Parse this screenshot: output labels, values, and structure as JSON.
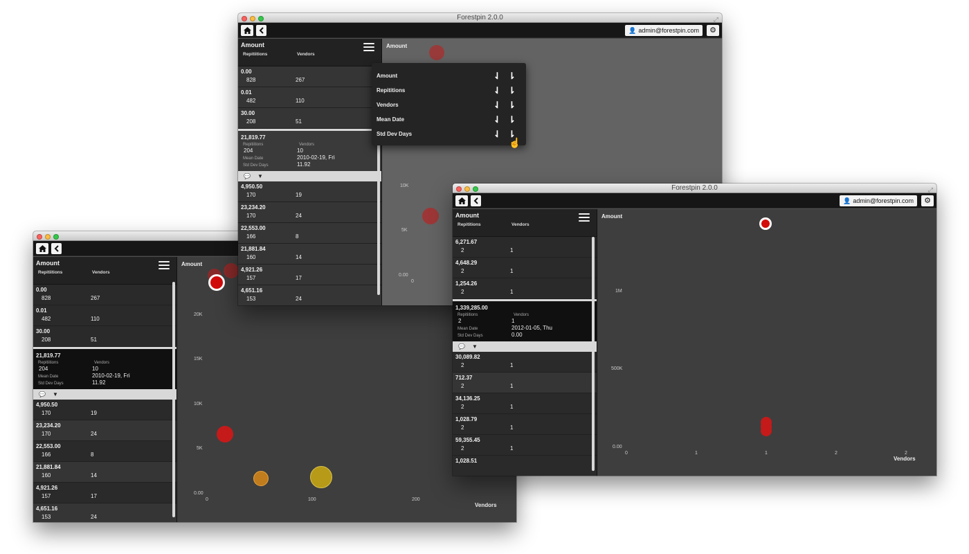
{
  "app": {
    "title": "Forestpin 2.0.0",
    "user": "admin@forestpin.com"
  },
  "panel": {
    "title": "Amount",
    "col_reps": "Repitiitions",
    "col_vendors": "Vendors",
    "detail_reps": "Repitiitions",
    "detail_vendors": "Vendors",
    "detail_mean": "Mean Date",
    "detail_std": "Std Dev Days"
  },
  "panel_right": {
    "col_reps": "Repititions"
  },
  "list_a": [
    {
      "amount": "0.00",
      "reps": "828",
      "vendors": "267"
    },
    {
      "amount": "0.01",
      "reps": "482",
      "vendors": "110"
    },
    {
      "amount": "30.00",
      "reps": "208",
      "vendors": "51"
    }
  ],
  "selected_a": {
    "amount": "21,819.77",
    "reps": "204",
    "vendors": "10",
    "mean_date": "2010-02-19, Fri",
    "std_dev": "11.92"
  },
  "list_a2_top": [
    {
      "amount": "4,950.50",
      "reps": "170",
      "vendors": "19"
    },
    {
      "amount": "23,234.20",
      "reps": "170",
      "vendors": "24"
    },
    {
      "amount": "22,553.00",
      "reps": "166",
      "vendors": "8"
    },
    {
      "amount": "21,881.84",
      "reps": "160",
      "vendors": "14"
    },
    {
      "amount": "4,921.26",
      "reps": "157",
      "vendors": "17"
    },
    {
      "amount": "4,651.16",
      "reps": "153",
      "vendors": "24"
    }
  ],
  "list_b_top": [
    {
      "amount": "6,271.67",
      "reps": "2",
      "vendors": "1"
    },
    {
      "amount": "4,648.29",
      "reps": "2",
      "vendors": "1"
    },
    {
      "amount": "1,254.26",
      "reps": "2",
      "vendors": "1"
    }
  ],
  "selected_b": {
    "amount": "1,339,285.00",
    "reps": "2",
    "vendors": "1",
    "mean_date": "2012-01-05, Thu",
    "std_dev": "0.00"
  },
  "list_b2": [
    {
      "amount": "30,089.82",
      "reps": "2",
      "vendors": "1"
    },
    {
      "amount": "712.37",
      "reps": "2",
      "vendors": "1"
    },
    {
      "amount": "34,136.25",
      "reps": "2",
      "vendors": "1"
    },
    {
      "amount": "1,028.79",
      "reps": "2",
      "vendors": "1"
    },
    {
      "amount": "59,355.45",
      "reps": "2",
      "vendors": "1"
    },
    {
      "amount": "1,028.51",
      "reps": "",
      "vendors": ""
    }
  ],
  "chart": {
    "ylabel": "Amount",
    "xlabel": "Vendors",
    "left_y_ticks": [
      "20K",
      "15K",
      "10K",
      "5K",
      "0.00"
    ],
    "left_x_ticks": [
      "0",
      "100",
      "200"
    ],
    "top_y_ticks": [
      "10K",
      "5K",
      "0.00"
    ],
    "top_x_ticks": [
      "0"
    ],
    "right_y_ticks": [
      "1M",
      "500K",
      "0.00"
    ],
    "right_x_ticks": [
      "0",
      "1",
      "1",
      "2",
      "2"
    ]
  },
  "sort_menu": [
    "Amount",
    "Repititions",
    "Vendors",
    "Mean Date",
    "Std Dev Days"
  ],
  "colors": {
    "bubble_red": "#c51a1a",
    "bubble_orange": "#c07c1d",
    "bubble_olive": "#b69a18"
  },
  "icons": {
    "home": "home-icon",
    "back": "chevron-left-icon",
    "user": "user-icon",
    "gear": "gear-icon",
    "menu": "hamburger-icon",
    "comment": "comment-icon",
    "filter": "filter-icon",
    "sort_desc": "sort-descending-icon",
    "sort_asc": "sort-ascending-icon"
  }
}
